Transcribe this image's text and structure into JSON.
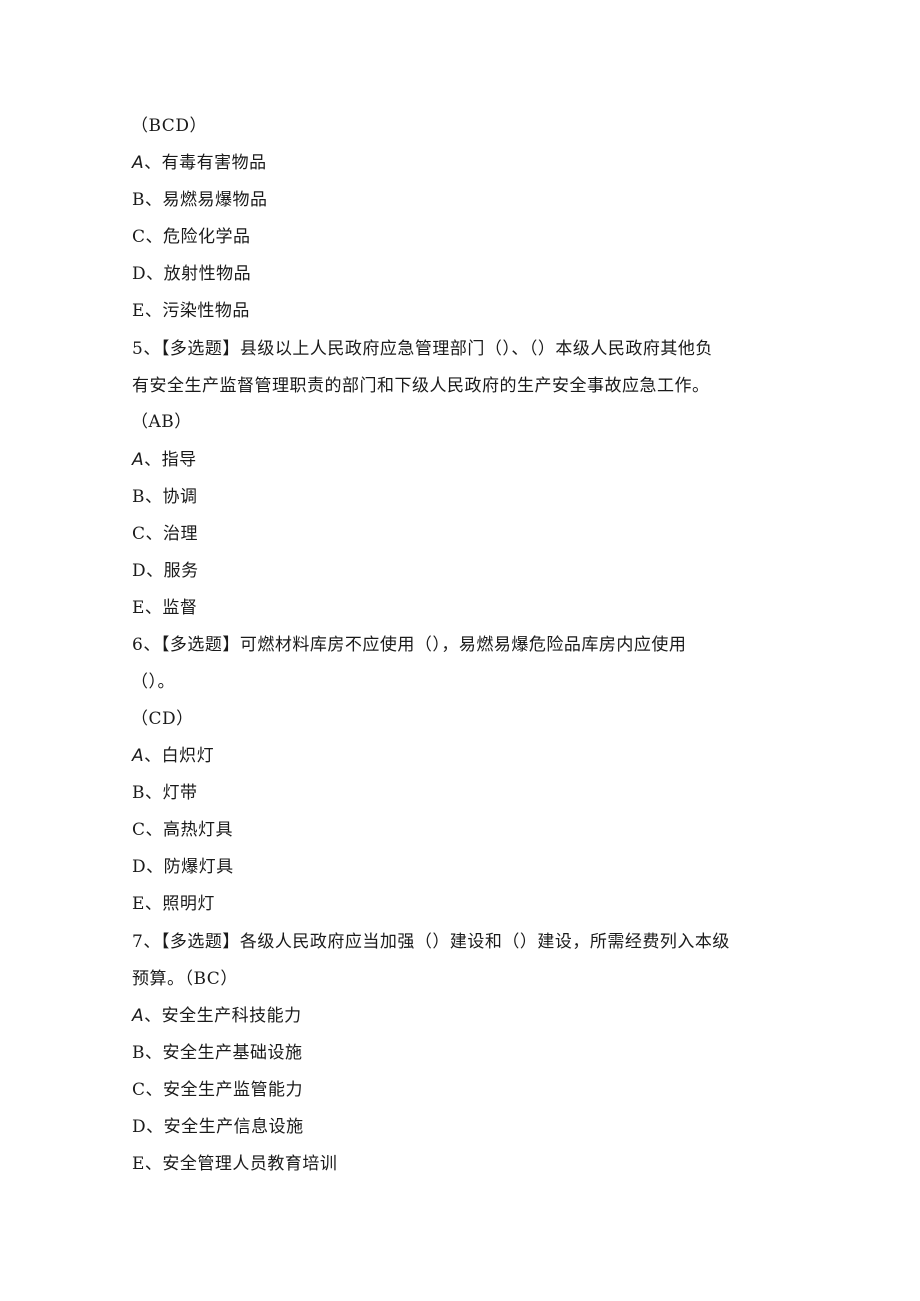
{
  "document": {
    "q4_tail": {
      "answer": "（BCD）",
      "options": [
        {
          "letter": "A",
          "text": "、有毒有害物品"
        },
        {
          "letter": "B",
          "text": "、易燃易爆物品"
        },
        {
          "letter": "C",
          "text": "、危险化学品"
        },
        {
          "letter": "D",
          "text": "、放射性物品"
        },
        {
          "letter": "E",
          "text": "、污染性物品"
        }
      ]
    },
    "q5": {
      "line1": "5、【多选题】县级以上人民政府应急管理部门（）、（）本级人民政府其他负",
      "line2": "有安全生产监督管理职责的部门和下级人民政府的生产安全事故应急工作。",
      "answer": "（AB）",
      "options": [
        {
          "letter": "A",
          "text": "、指导"
        },
        {
          "letter": "B",
          "text": "、协调"
        },
        {
          "letter": "C",
          "text": "、治理"
        },
        {
          "letter": "D",
          "text": "、服务"
        },
        {
          "letter": "E",
          "text": "、监督"
        }
      ]
    },
    "q6": {
      "line1": "6、【多选题】可燃材料库房不应使用（），易燃易爆危险品库房内应使用",
      "line2": "（）。",
      "answer": "（CD）",
      "options": [
        {
          "letter": "A",
          "text": "、白炽灯"
        },
        {
          "letter": "B",
          "text": "、灯带"
        },
        {
          "letter": "C",
          "text": "、高热灯具"
        },
        {
          "letter": "D",
          "text": "、防爆灯具"
        },
        {
          "letter": "E",
          "text": "、照明灯"
        }
      ]
    },
    "q7": {
      "line1": "7、【多选题】各级人民政府应当加强（）建设和（）建设，所需经费列入本级",
      "line2": "预算。（BC）",
      "options": [
        {
          "letter": "A",
          "text": "、安全生产科技能力"
        },
        {
          "letter": "B",
          "text": "、安全生产基础设施"
        },
        {
          "letter": "C",
          "text": "、安全生产监管能力"
        },
        {
          "letter": "D",
          "text": "、安全生产信息设施"
        },
        {
          "letter": "E",
          "text": "、安全管理人员教育培训"
        }
      ]
    }
  }
}
